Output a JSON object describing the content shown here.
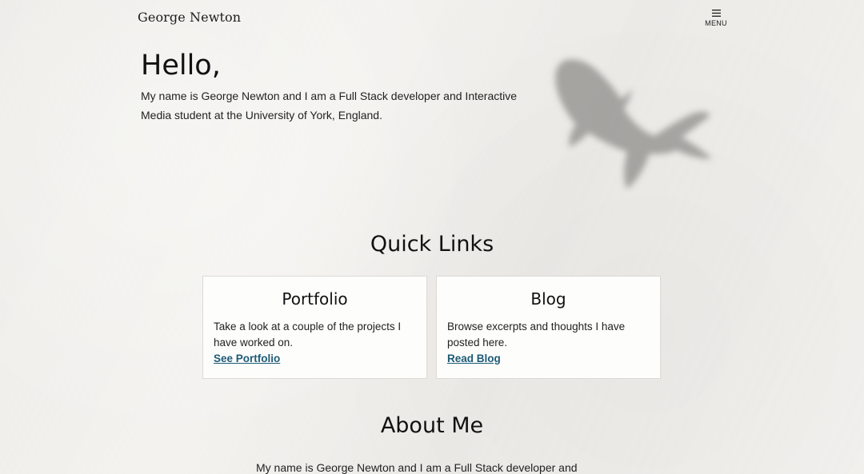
{
  "header": {
    "site_title": "George Newton",
    "menu_label": "MENU"
  },
  "hero": {
    "heading": "Hello,",
    "text": "My name is George Newton and I am a Full Stack developer and Interactive Media student at the University of York, England."
  },
  "quick_links": {
    "heading": "Quick Links",
    "cards": [
      {
        "title": "Portfolio",
        "text": "Take a look at a couple of the projects I have worked on.",
        "link": "See Portfolio"
      },
      {
        "title": "Blog",
        "text": "Browse excerpts and thoughts I have posted here.",
        "link": "Read Blog"
      }
    ]
  },
  "about": {
    "heading": "About Me",
    "text": "My name is George Newton and I am a Full Stack developer and"
  },
  "icons": {
    "menu": "hamburger-menu-icon",
    "decoration": "fish-shadow"
  },
  "colors": {
    "background": "#f1efeb",
    "card_background": "#fdfdfc",
    "link": "#1d5a76",
    "text": "#161616"
  }
}
